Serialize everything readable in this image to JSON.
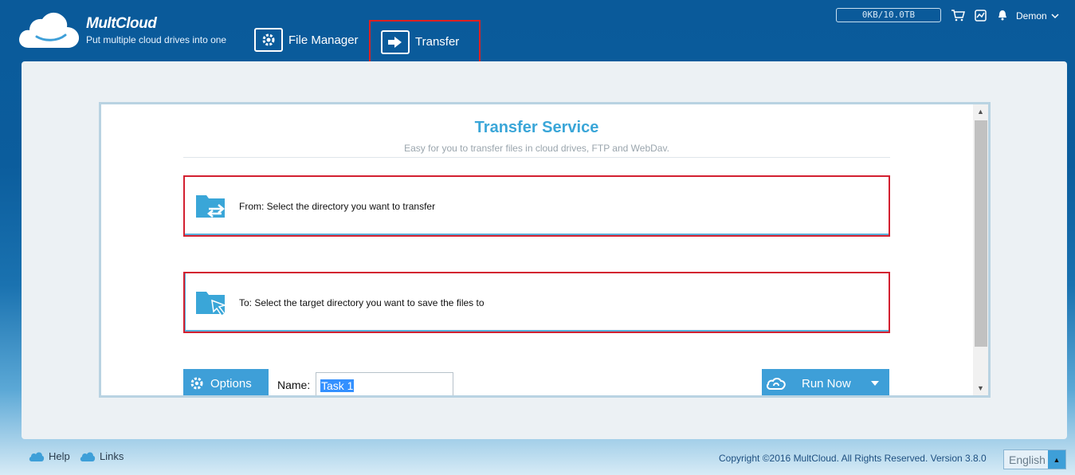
{
  "brand": {
    "name": "MultCloud",
    "tagline": "Put multiple cloud drives into one"
  },
  "nav": {
    "file_manager": "File Manager",
    "transfer": "Transfer"
  },
  "topbar": {
    "storage": "0KB/10.0TB",
    "user": "Demon",
    "icons": [
      "cart-icon",
      "chart-icon",
      "bell-icon"
    ]
  },
  "transfer": {
    "title": "Transfer Service",
    "subtitle": "Easy for you to transfer files in cloud drives, FTP and WebDav.",
    "from_text": "From: Select the directory you want to transfer",
    "to_text": "To: Select the target directory you want to save the files to",
    "options_label": "Options",
    "name_label": "Name:",
    "name_value": "Task 1",
    "run_label": "Run Now"
  },
  "footer": {
    "help": "Help",
    "links": "Links",
    "copyright": "Copyright ©2016 MultCloud. All Rights Reserved. Version 3.8.0",
    "language": "English"
  },
  "colors": {
    "accent": "#3e9fd8",
    "title": "#3aa6d8",
    "highlight": "#d32030"
  }
}
